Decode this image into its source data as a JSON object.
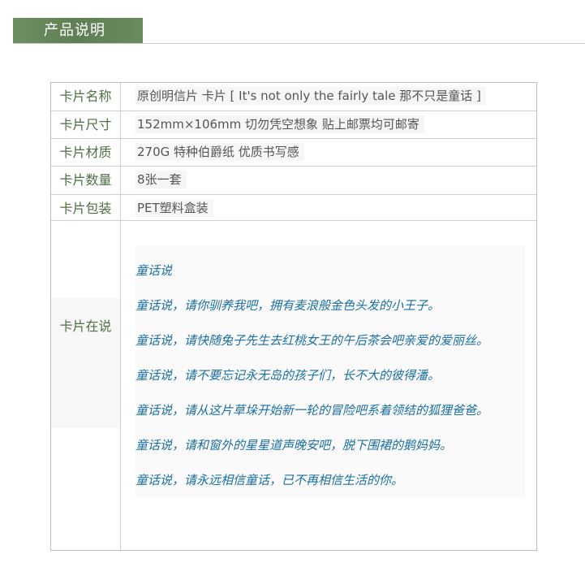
{
  "header": {
    "title": "产品说明"
  },
  "table": {
    "rows": [
      {
        "label": "卡片名称",
        "value": "原创明信片 卡片 [ It's not only the fairly tale 那不只是童话 ]"
      },
      {
        "label": "卡片尺寸",
        "value": "152mm×106mm    切勿凭空想象    贴上邮票均可邮寄"
      },
      {
        "label": "卡片材质",
        "value": "270G 特种伯爵纸 优质书写感"
      },
      {
        "label": "卡片数量",
        "value": "8张一套"
      },
      {
        "label": "卡片包装",
        "value": "PET塑料盒装"
      }
    ],
    "story": {
      "label": "卡片在说",
      "lines": [
        "童话说",
        "童话说，请你驯养我吧，拥有麦浪般金色头发的小王子。",
        "童话说，请快随兔子先生去红桃女王的午后茶会吧亲爱的爱丽丝。",
        "童话说，请不要忘记永无岛的孩子们，长不大的彼得潘。",
        "童话说，请从这片草垛开始新一轮的冒险吧系着领结的狐狸爸爸。",
        "童话说，请和窗外的星星道声晚安吧，脱下围裙的鹅妈妈。",
        "童话说，请永远相信童话，已不再相信生活的你。"
      ]
    }
  }
}
